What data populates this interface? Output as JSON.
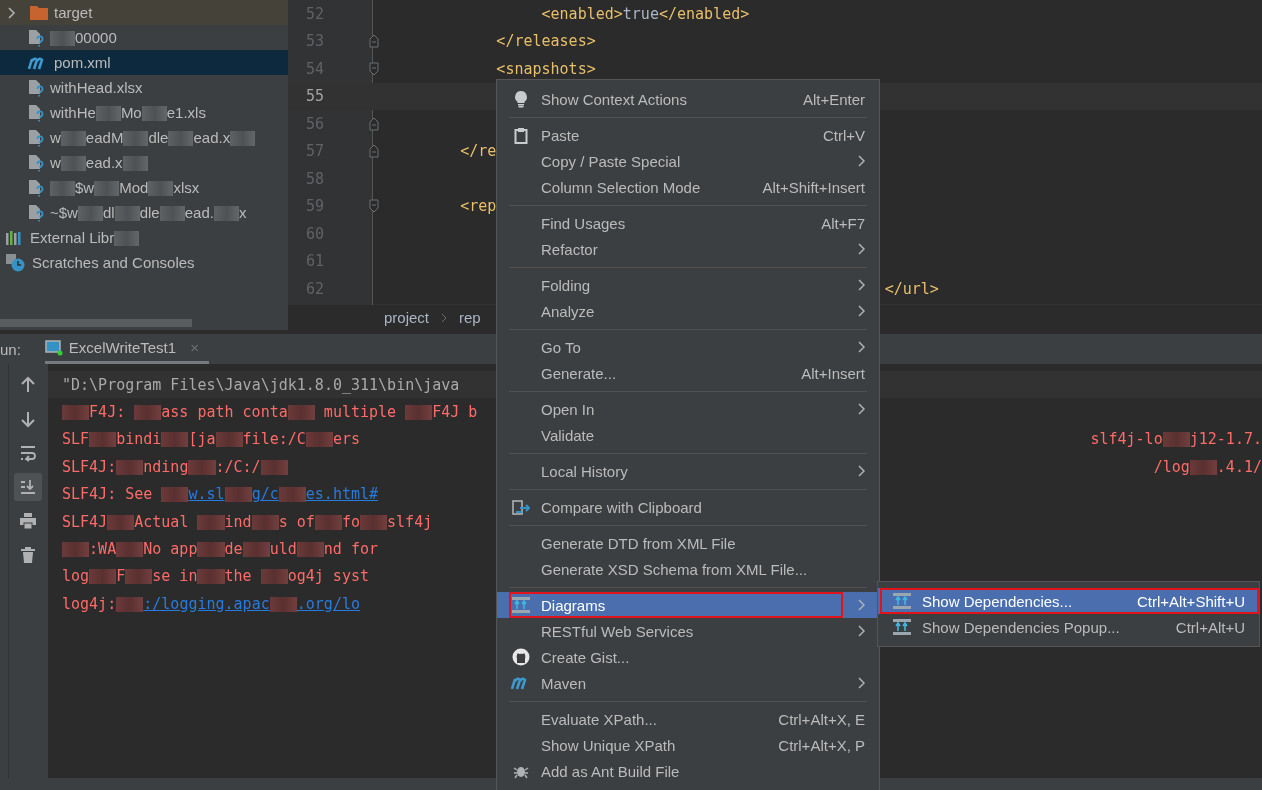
{
  "project_tree": {
    "items": [
      {
        "kind": "folder",
        "expanded": false,
        "selected": false,
        "segments": [
          {
            "text": "target"
          }
        ]
      },
      {
        "kind": "file",
        "selected": false,
        "segments": [
          {
            "kind": "redacted"
          },
          {
            "text": "00000"
          }
        ]
      },
      {
        "kind": "maven",
        "selected": true,
        "segments": [
          {
            "text": "pom.xml"
          }
        ]
      },
      {
        "kind": "file",
        "selected": false,
        "segments": [
          {
            "text": "withHead.xlsx"
          }
        ]
      },
      {
        "kind": "file",
        "selected": false,
        "segments": [
          {
            "text": "withHe"
          },
          {
            "kind": "redacted"
          },
          {
            "text": "Mo"
          },
          {
            "kind": "redacted"
          },
          {
            "text": "e1.xls"
          }
        ]
      },
      {
        "kind": "file",
        "selected": false,
        "segments": [
          {
            "text": "w"
          },
          {
            "kind": "redacted"
          },
          {
            "text": "eadM"
          },
          {
            "kind": "redacted"
          },
          {
            "text": "dle"
          },
          {
            "kind": "redacted"
          },
          {
            "text": "ead.x"
          },
          {
            "kind": "redacted"
          }
        ]
      },
      {
        "kind": "file",
        "selected": false,
        "segments": [
          {
            "text": "w"
          },
          {
            "kind": "redacted"
          },
          {
            "text": "ead.x"
          },
          {
            "kind": "redacted"
          }
        ]
      },
      {
        "kind": "file",
        "selected": false,
        "segments": [
          {
            "kind": "redacted"
          },
          {
            "text": "$w"
          },
          {
            "kind": "redacted"
          },
          {
            "text": "Mod"
          },
          {
            "kind": "redacted"
          },
          {
            "text": "xlsx"
          }
        ]
      },
      {
        "kind": "file",
        "selected": false,
        "segments": [
          {
            "text": "~$w"
          },
          {
            "kind": "redacted"
          },
          {
            "text": "dl"
          },
          {
            "kind": "redacted"
          },
          {
            "text": "dle"
          },
          {
            "kind": "redacted"
          },
          {
            "text": "ead."
          },
          {
            "kind": "redacted"
          },
          {
            "text": "x"
          }
        ]
      },
      {
        "kind": "library",
        "selected": false,
        "segments": [
          {
            "text": "External Libr"
          },
          {
            "kind": "redacted"
          }
        ]
      },
      {
        "kind": "scratch",
        "selected": false,
        "segments": [
          {
            "text": "Scratches and Consoles"
          }
        ]
      }
    ]
  },
  "editor": {
    "lines": [
      {
        "number": "52",
        "current": false,
        "kind": "plain",
        "segments": [
          {
            "kind": "tag",
            "text": "<enabled>"
          },
          {
            "text": "true"
          },
          {
            "kind": "tag",
            "text": "</enabled>"
          }
        ]
      },
      {
        "number": "53",
        "current": false,
        "kind": "fold-end",
        "segments": [
          {
            "kind": "tag",
            "text": "</releases>"
          }
        ]
      },
      {
        "number": "54",
        "current": false,
        "kind": "fold-start",
        "segments": [
          {
            "kind": "tag",
            "text": "<snapshots>"
          }
        ]
      },
      {
        "number": "55",
        "current": true,
        "kind": "plain"
      },
      {
        "number": "56",
        "current": false,
        "kind": "fold-end"
      },
      {
        "number": "57",
        "current": false,
        "kind": "fold-end",
        "segments": [
          {
            "kind": "tag",
            "text": "</re"
          }
        ]
      },
      {
        "number": "58",
        "current": false,
        "kind": "plain"
      },
      {
        "number": "59",
        "current": false,
        "kind": "fold-start",
        "segments": [
          {
            "kind": "tag",
            "text": "<rep"
          }
        ]
      },
      {
        "number": "60",
        "current": false,
        "kind": "plain"
      },
      {
        "number": "61",
        "current": false,
        "kind": "plain"
      },
      {
        "number": "62",
        "current": false,
        "kind": "plain",
        "segments": [
          {
            "kind": "tag",
            "text": "</url>"
          }
        ]
      }
    ],
    "breadcrumbs": [
      "project",
      "rep"
    ]
  },
  "run_panel": {
    "label": "un:",
    "tab": {
      "title": "ExcelWriteTest1",
      "close": "×"
    },
    "toolbar": [
      {
        "selected": false
      },
      {
        "selected": false
      },
      {
        "selected": false
      },
      {
        "selected": true
      },
      {
        "selected": false
      },
      {
        "selected": false
      }
    ],
    "console": [
      {
        "kind": "command",
        "segments": [
          {
            "text": "\"D:\\Program Files\\Java\\jdk1.8.0_311\\bin\\java"
          }
        ]
      },
      {
        "kind": "error",
        "segments": [
          {
            "kind": "redacted"
          },
          {
            "text": "F4J: "
          },
          {
            "kind": "redacted"
          },
          {
            "text": "ass path conta"
          },
          {
            "kind": "redacted"
          },
          {
            "text": " multiple "
          },
          {
            "kind": "redacted"
          },
          {
            "text": "F4J b"
          }
        ]
      },
      {
        "kind": "error",
        "segments": [
          {
            "text": "SLF"
          },
          {
            "kind": "redacted"
          },
          {
            "text": "bindi"
          },
          {
            "kind": "redacted"
          },
          {
            "text": "[ja"
          },
          {
            "kind": "redacted"
          },
          {
            "text": "file:/C"
          },
          {
            "kind": "redacted"
          },
          {
            "text": "ers"
          }
        ],
        "tail": [
          {
            "text": "slf4j-lo"
          },
          {
            "kind": "redacted"
          },
          {
            "text": "j12-1.7."
          }
        ]
      },
      {
        "kind": "error",
        "segments": [
          {
            "text": "SLF4J:"
          },
          {
            "kind": "redacted"
          },
          {
            "text": "nding"
          },
          {
            "kind": "redacted"
          },
          {
            "text": ":/C:/"
          },
          {
            "kind": "redacted"
          }
        ],
        "tail": [
          {
            "text": "/log"
          },
          {
            "kind": "redacted"
          },
          {
            "text": ".4.1/"
          }
        ]
      },
      {
        "kind": "error",
        "segments": [
          {
            "text": "SLF4J: See "
          },
          {
            "kind": "redacted"
          },
          {
            "kind": "link",
            "text": "w.sl"
          },
          {
            "kind": "redacted"
          },
          {
            "kind": "link",
            "text": "g/c"
          },
          {
            "kind": "redacted"
          },
          {
            "kind": "link",
            "text": "es.html#"
          }
        ]
      },
      {
        "kind": "error",
        "segments": [
          {
            "text": "SLF4J"
          },
          {
            "kind": "redacted"
          },
          {
            "text": "Actual "
          },
          {
            "kind": "redacted"
          },
          {
            "text": "ind"
          },
          {
            "kind": "redacted"
          },
          {
            "text": "s of"
          },
          {
            "kind": "redacted"
          },
          {
            "text": "fo"
          },
          {
            "kind": "redacted"
          },
          {
            "text": "slf4j"
          }
        ]
      },
      {
        "kind": "error",
        "segments": [
          {
            "kind": "redacted"
          },
          {
            "text": ":WA"
          },
          {
            "kind": "redacted"
          },
          {
            "text": "No app"
          },
          {
            "kind": "redacted"
          },
          {
            "text": "de"
          },
          {
            "kind": "redacted"
          },
          {
            "text": "uld"
          },
          {
            "kind": "redacted"
          },
          {
            "text": "nd for"
          }
        ]
      },
      {
        "kind": "error",
        "segments": [
          {
            "text": "log"
          },
          {
            "kind": "redacted"
          },
          {
            "text": "F"
          },
          {
            "kind": "redacted"
          },
          {
            "text": "se in"
          },
          {
            "kind": "redacted"
          },
          {
            "text": "the "
          },
          {
            "kind": "redacted"
          },
          {
            "text": "og4j syst"
          }
        ]
      },
      {
        "kind": "error",
        "segments": [
          {
            "text": "log4j:"
          },
          {
            "kind": "redacted"
          },
          {
            "kind": "link",
            "text": ":/logging.apac"
          },
          {
            "kind": "redacted"
          },
          {
            "kind": "link",
            "text": ".org/lo"
          }
        ]
      }
    ]
  },
  "context_menu": {
    "items": [
      {
        "kind": "item",
        "label": "Show Context Actions",
        "shortcut": "Alt+Enter",
        "submenu": false,
        "selected": false,
        "annotated": false
      },
      {
        "kind": "separator"
      },
      {
        "kind": "item",
        "label": "Paste",
        "shortcut": "Ctrl+V",
        "submenu": false,
        "selected": false,
        "annotated": false
      },
      {
        "kind": "item",
        "label": "Copy / Paste Special",
        "submenu": true,
        "selected": false,
        "annotated": false
      },
      {
        "kind": "item",
        "label": "Column Selection Mode",
        "shortcut": "Alt+Shift+Insert",
        "submenu": false,
        "selected": false,
        "annotated": false
      },
      {
        "kind": "separator"
      },
      {
        "kind": "item",
        "label": "Find Usages",
        "shortcut": "Alt+F7",
        "submenu": false,
        "selected": false,
        "annotated": false
      },
      {
        "kind": "item",
        "label": "Refactor",
        "submenu": true,
        "selected": false,
        "annotated": false
      },
      {
        "kind": "separator"
      },
      {
        "kind": "item",
        "label": "Folding",
        "submenu": true,
        "selected": false,
        "annotated": false
      },
      {
        "kind": "item",
        "label": "Analyze",
        "submenu": true,
        "selected": false,
        "annotated": false
      },
      {
        "kind": "separator"
      },
      {
        "kind": "item",
        "label": "Go To",
        "submenu": true,
        "selected": false,
        "annotated": false
      },
      {
        "kind": "item",
        "label": "Generate...",
        "shortcut": "Alt+Insert",
        "submenu": false,
        "selected": false,
        "annotated": false
      },
      {
        "kind": "separator"
      },
      {
        "kind": "item",
        "label": "Open In",
        "submenu": true,
        "selected": false,
        "annotated": false
      },
      {
        "kind": "item",
        "label": "Validate",
        "submenu": false,
        "selected": false,
        "annotated": false
      },
      {
        "kind": "separator"
      },
      {
        "kind": "item",
        "label": "Local History",
        "submenu": true,
        "selected": false,
        "annotated": false
      },
      {
        "kind": "separator"
      },
      {
        "kind": "item",
        "label": "Compare with Clipboard",
        "submenu": false,
        "selected": false,
        "annotated": false
      },
      {
        "kind": "separator"
      },
      {
        "kind": "item",
        "label": "Generate DTD from XML File",
        "submenu": false,
        "selected": false,
        "annotated": false
      },
      {
        "kind": "item",
        "label": "Generate XSD Schema from XML File...",
        "submenu": false,
        "selected": false,
        "annotated": false
      },
      {
        "kind": "separator"
      },
      {
        "kind": "item",
        "label": "Diagrams",
        "submenu": true,
        "selected": true,
        "annotated": true
      },
      {
        "kind": "item",
        "label": "RESTful Web Services",
        "submenu": true,
        "selected": false,
        "annotated": false
      },
      {
        "kind": "item",
        "label": "Create Gist...",
        "submenu": false,
        "selected": false,
        "annotated": false
      },
      {
        "kind": "item",
        "label": "Maven",
        "submenu": true,
        "selected": false,
        "annotated": false
      },
      {
        "kind": "separator"
      },
      {
        "kind": "item",
        "label": "Evaluate XPath...",
        "shortcut": "Ctrl+Alt+X, E",
        "submenu": false,
        "selected": false,
        "annotated": false
      },
      {
        "kind": "item",
        "label": "Show Unique XPath",
        "shortcut": "Ctrl+Alt+X, P",
        "submenu": false,
        "selected": false,
        "annotated": false
      },
      {
        "kind": "item",
        "label": "Add as Ant Build File",
        "submenu": false,
        "selected": false,
        "annotated": false
      }
    ]
  },
  "submenu": {
    "items": [
      {
        "label": "Show Dependencies...",
        "shortcut": "Ctrl+Alt+Shift+U",
        "selected": true,
        "annotated": true
      },
      {
        "label": "Show Dependencies Popup...",
        "shortcut": "Ctrl+Alt+U",
        "selected": false,
        "annotated": false
      }
    ]
  }
}
